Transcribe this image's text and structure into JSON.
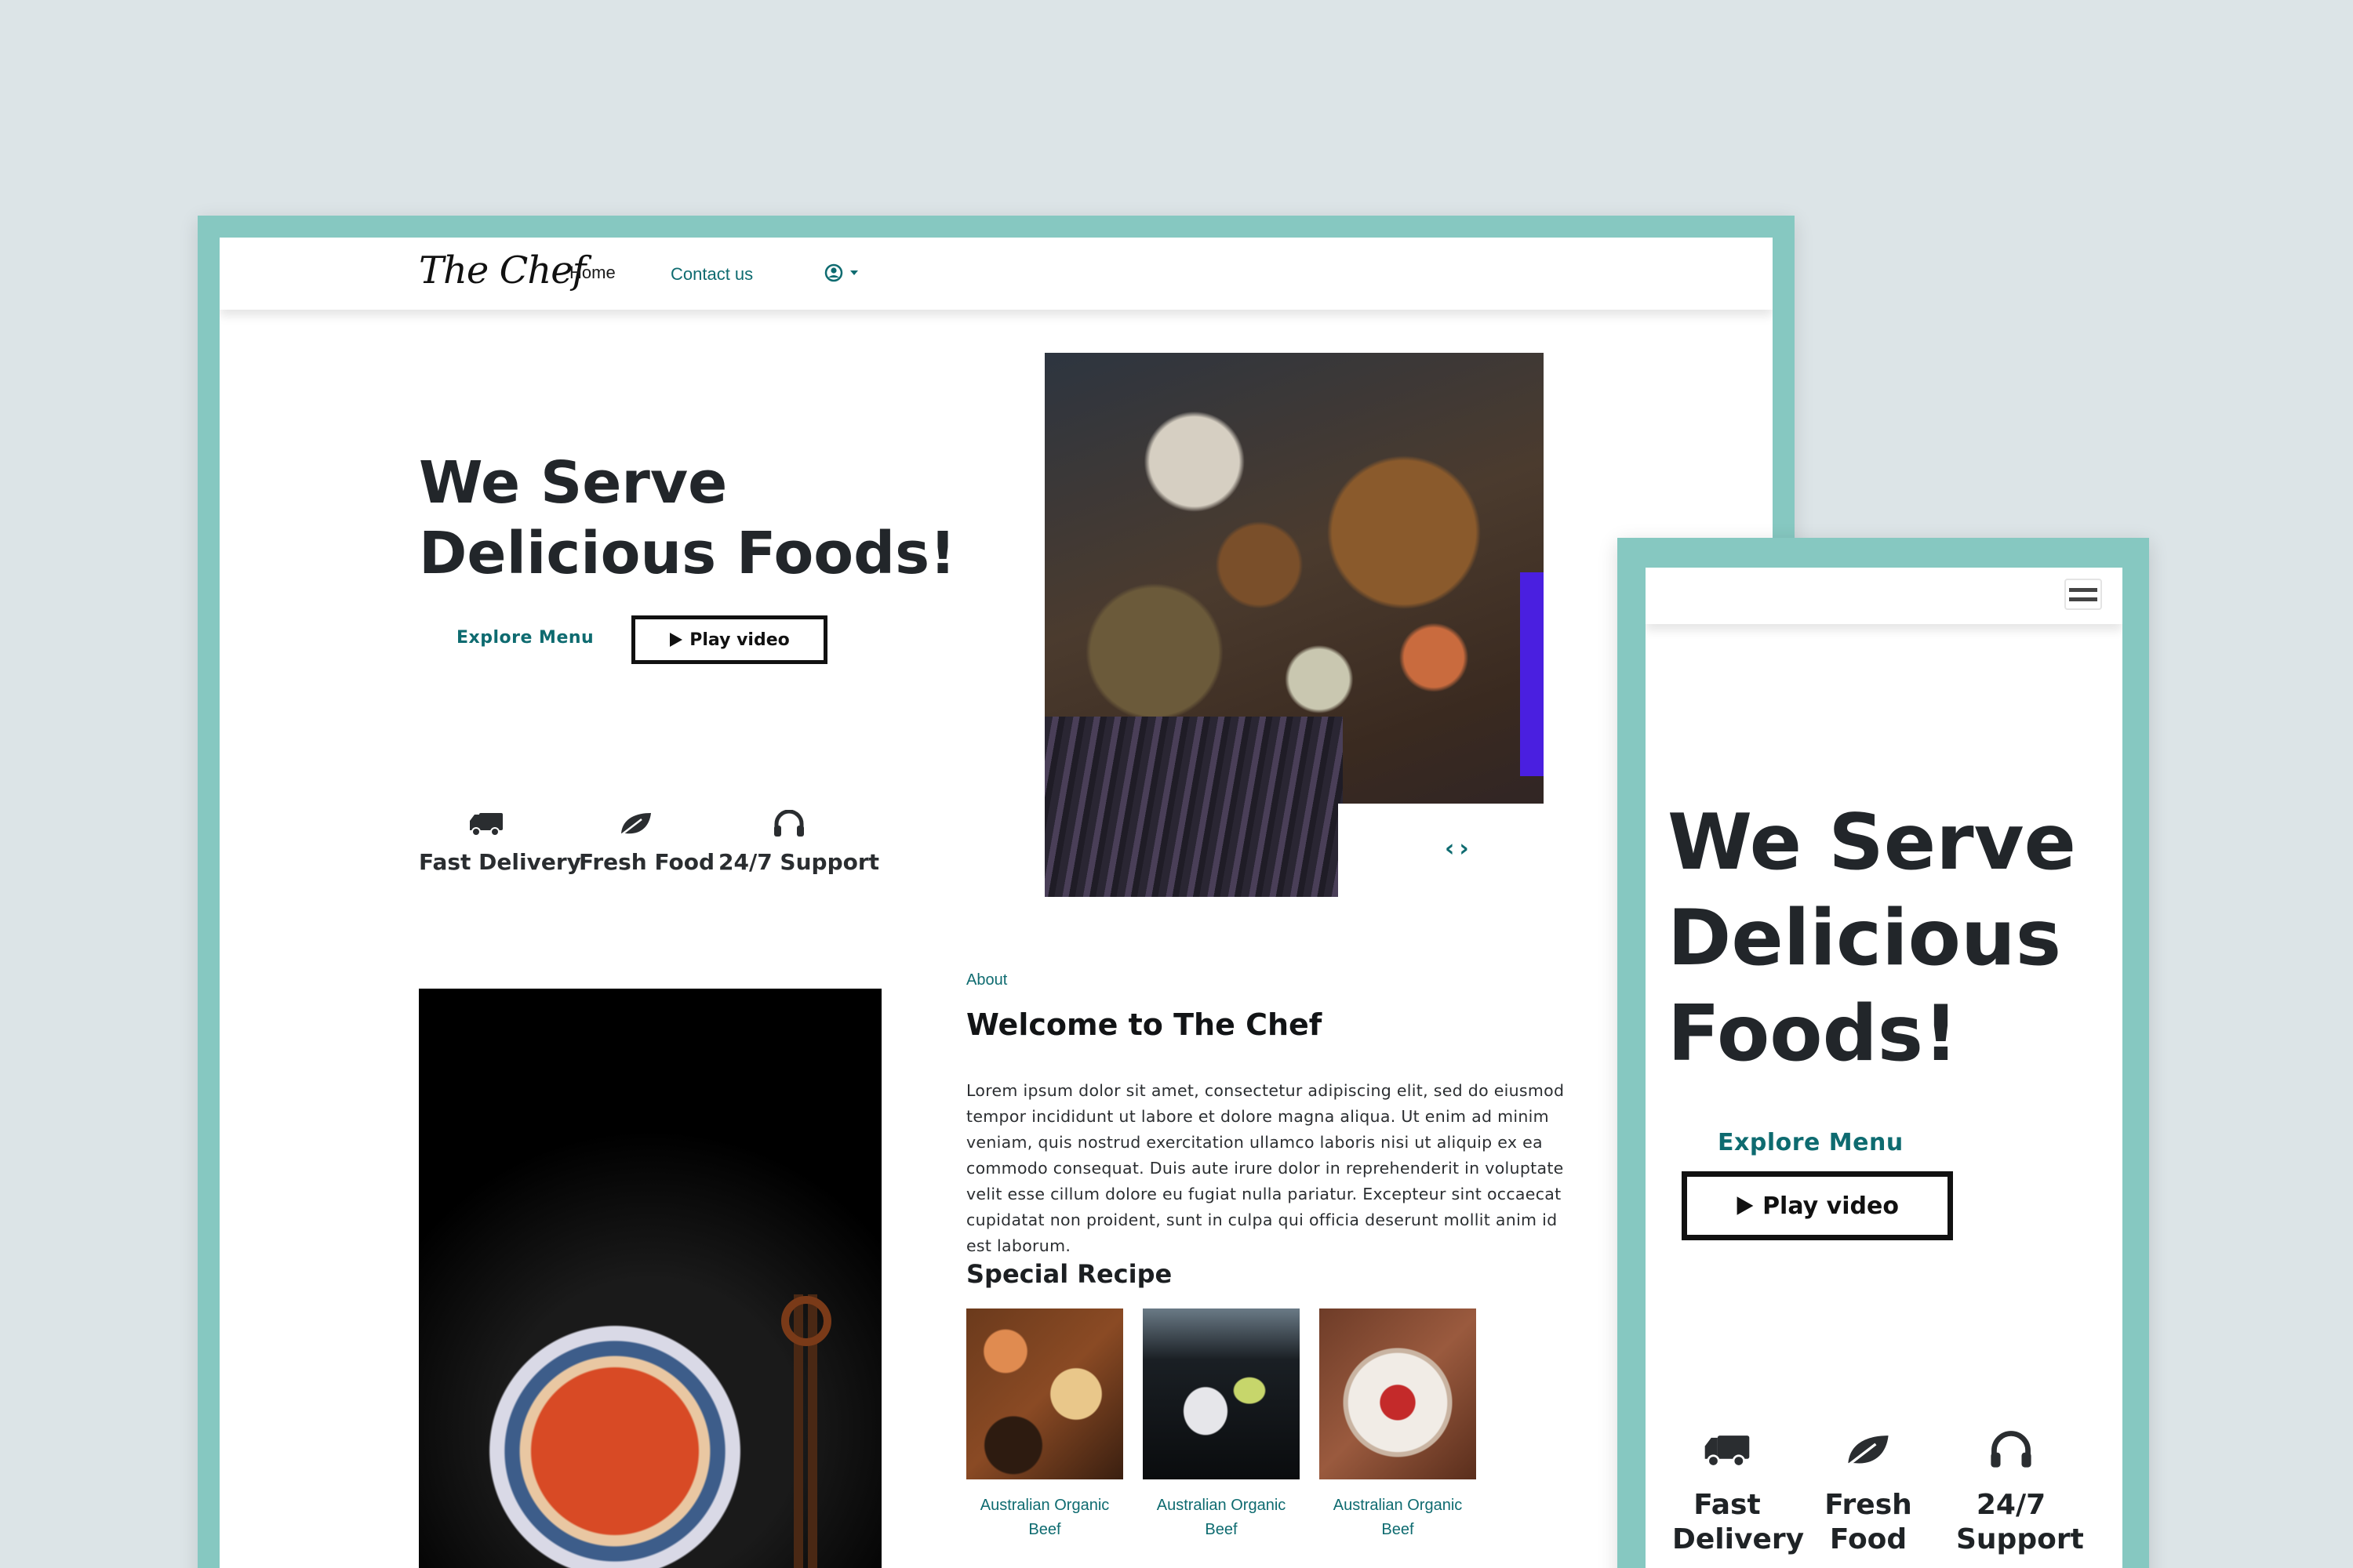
{
  "desktop": {
    "nav": {
      "logo": "The Chef",
      "home": "Home",
      "contact": "Contact us",
      "user_icon": "user-circle-icon"
    },
    "hero": {
      "title_line1": "We Serve",
      "title_line2": "Delicious Foods!",
      "explore_label": "Explore Menu",
      "play_label": "Play video"
    },
    "features": [
      {
        "icon": "truck-icon",
        "label": "Fast Delivery"
      },
      {
        "icon": "leaf-icon",
        "label": "Fresh Food"
      },
      {
        "icon": "headphones-icon",
        "label": "24/7 Support"
      }
    ],
    "about": {
      "label": "About",
      "title": "Welcome to The Chef",
      "text": "Lorem ipsum dolor sit amet, consectetur adipiscing elit, sed do eiusmod tempor incididunt ut labore et dolore magna aliqua. Ut enim ad minim veniam, quis nostrud exercitation ullamco laboris nisi ut aliquip ex ea commodo consequat. Duis aute irure dolor in reprehenderit in voluptate velit esse cillum dolore eu fugiat nulla pariatur. Excepteur sint occaecat cupidatat non proident, sunt in culpa qui officia deserunt mollit anim id est laborum."
    },
    "special": {
      "title": "Special Recipe",
      "items": [
        {
          "line1": "Australian Organic",
          "line2": "Beef"
        },
        {
          "line1": "Australian Organic",
          "line2": "Beef"
        },
        {
          "line1": "Australian Organic",
          "line2": "Beef"
        }
      ]
    }
  },
  "mobile": {
    "hero": {
      "title_line1": "We Serve",
      "title_line2": "Delicious",
      "title_line3": "Foods!",
      "explore_label": "Explore Menu",
      "play_label": "Play video"
    },
    "features": [
      {
        "icon": "truck-icon",
        "label": "Fast Delivery"
      },
      {
        "icon": "leaf-icon",
        "label": "Fresh Food"
      },
      {
        "icon": "headphones-icon",
        "label": "24/7 Support"
      }
    ]
  },
  "colors": {
    "accent": "#0e6b70",
    "frame": "#86c8c1",
    "background": "#dce4e7"
  }
}
